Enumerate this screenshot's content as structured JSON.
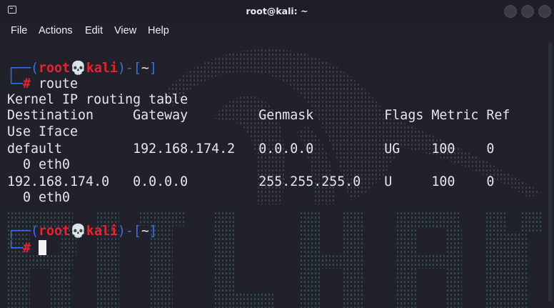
{
  "window": {
    "title": "root@kali: ~",
    "icon": "terminal-icon",
    "buttons": [
      "minimize-icon",
      "maximize-icon",
      "close-icon"
    ]
  },
  "menu": {
    "file": "File",
    "actions": "Actions",
    "edit": "Edit",
    "view": "View",
    "help": "Help"
  },
  "terminal": {
    "prompt1": {
      "frame_open": "┌──(",
      "user": "root",
      "skull": "💀",
      "host": "kali",
      "frame_mid": ")-[",
      "dir": "~",
      "frame_close": "]",
      "corner": "└─",
      "hash": "#",
      "command": " route"
    },
    "output": [
      "Kernel IP routing table",
      "Destination     Gateway         Genmask         Flags Metric Ref",
      "Use Iface",
      "default         192.168.174.2   0.0.0.0         UG    100    0",
      "  0 eth0",
      "192.168.174.0   0.0.0.0         255.255.255.0   U     100    0",
      "  0 eth0"
    ],
    "prompt2": {
      "frame_open": "┌──(",
      "user": "root",
      "skull": "💀",
      "host": "kali",
      "frame_mid": ")-[",
      "dir": "~",
      "frame_close": "]",
      "corner": "└─",
      "hash": "#"
    },
    "colors": {
      "frame": "#3b6ee8",
      "user_host": "#e8222e",
      "text": "#e6e6ec",
      "background": "#20212b"
    }
  }
}
